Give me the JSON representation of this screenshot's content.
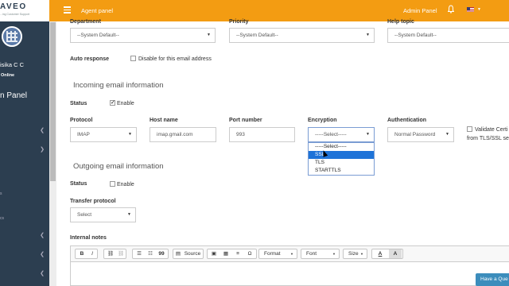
{
  "header": {
    "logo_text": "AVEO",
    "logo_tagline": "...ing Customer Support",
    "title": "Agent panel",
    "admin_menu": "Admin Panel"
  },
  "sidebar": {
    "user_name": "isika C C",
    "status": "Online",
    "panel_label": "n Panel",
    "fragment_1": "s",
    "fragment_2": "cs"
  },
  "form": {
    "department": {
      "label": "Department",
      "value": "--System Default--"
    },
    "priority": {
      "label": "Priority",
      "value": "--System Default--"
    },
    "help_topic": {
      "label": "Help topic",
      "value": "--System Default--"
    },
    "auto_response": {
      "label": "Auto response",
      "checkbox_label": "Disable for this email address"
    },
    "incoming": {
      "title": "Incoming email information",
      "status_label": "Status",
      "status_checkbox": "Enable",
      "protocol": {
        "label": "Protocol",
        "value": "IMAP"
      },
      "host": {
        "label": "Host name",
        "value": "imap.gmail.com"
      },
      "port": {
        "label": "Port number",
        "value": "993"
      },
      "encryption": {
        "label": "Encryption",
        "value": "-----Select-----",
        "options": [
          "-----Select-----",
          "SSL",
          "TLS",
          "STARTTLS"
        ]
      },
      "authentication": {
        "label": "Authentication",
        "value": "Normal Password"
      },
      "validate": {
        "line1": "Validate Certi",
        "line2": "from TLS/SSL se"
      }
    },
    "outgoing": {
      "title": "Outgoing email information",
      "status_label": "Status",
      "status_checkbox": "Enable",
      "transfer": {
        "label": "Transfer protocol",
        "value": "Select"
      }
    },
    "notes": {
      "label": "Internal notes",
      "toolbar": {
        "bold": "B",
        "italic": "I",
        "source": "Source",
        "blockquote": "99",
        "omega": "Ω",
        "format": "Format",
        "font": "Font",
        "size": "Size",
        "text_color": "A",
        "bg_color": "A"
      }
    },
    "question_button": "Have a Que"
  }
}
